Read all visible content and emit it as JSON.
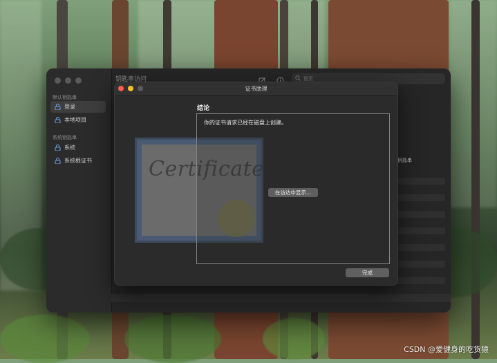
{
  "keychain_window": {
    "title": "钥匙串访问",
    "search_placeholder": "搜索",
    "sidebar": {
      "default_section": "默认钥匙串",
      "default_items": [
        {
          "label": "登录"
        },
        {
          "label": "本地项目"
        }
      ],
      "system_section": "系统钥匙串",
      "system_items": [
        {
          "label": "系统"
        },
        {
          "label": "系统根证书"
        }
      ]
    },
    "column_header": "钥匙串"
  },
  "dialog": {
    "title": "证书助理",
    "section_title": "结论",
    "message": "你的证书请求已经在磁盘上创建。",
    "show_in_finder_label": "在访达中显示...",
    "done_label": "完成",
    "certificate_text": "Certificate"
  },
  "watermark": "CSDN @爱健身的吃货猿",
  "colors": {
    "close": "#ff5f57",
    "minimize": "#febc2e",
    "zoom": "#5a5a5a"
  }
}
